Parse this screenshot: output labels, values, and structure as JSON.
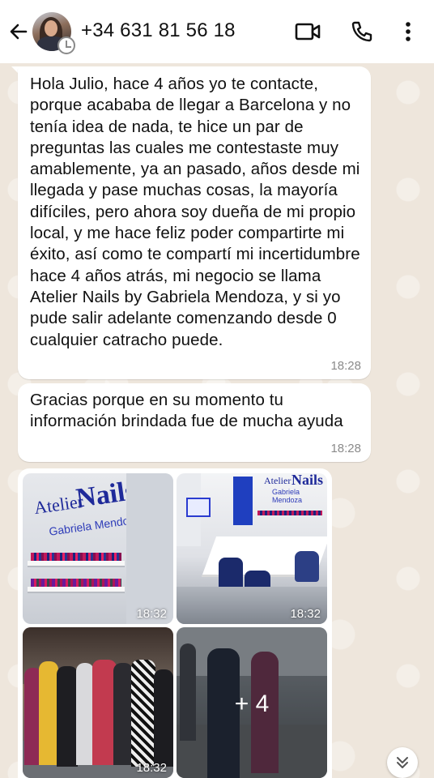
{
  "header": {
    "contact_name": "+34 631 81 56 18",
    "icons": [
      "back-arrow-icon",
      "avatar",
      "video-call-icon",
      "phone-icon",
      "more-vertical-icon"
    ]
  },
  "messages": [
    {
      "text": "Hola Julio, hace 4 años yo te contacte, porque acababa de llegar a Barcelona y no tenía idea de nada, te hice un par de preguntas las cuales me contestaste muy amablemente, ya an pasado, años desde mi llegada y pase muchas cosas, la mayoría difíciles, pero ahora soy dueña de mi propio local, y me hace feliz poder compartirte mi éxito, así como te compartí mi incertidumbre hace 4 años atrás, mi negocio se llama Atelier Nails by Gabriela Mendoza, y si yo pude salir adelante comenzando desde 0 cualquier catracho puede.",
      "time": "18:28"
    },
    {
      "text": "Gracias porque en su momento tu información brindada fue de mucha ayuda",
      "time": "18:28"
    }
  ],
  "album": {
    "photos": [
      {
        "time": "18:32",
        "logo_line1": "Atelier",
        "logo_line2": "Nails",
        "logo_line3": "Gabriela Mendoza"
      },
      {
        "time": "18:32",
        "logo_line1": "Atelier",
        "logo_line2": "Nails",
        "logo_line3": "Gabriela Mendoza"
      },
      {
        "time": "18:32"
      },
      {
        "more_label": "+ 4"
      }
    ]
  },
  "colors": {
    "header_bg": "#ffffff",
    "chat_bg": "#eee6dc",
    "bubble_bg": "#ffffff",
    "timestamp": "#8a8a8a",
    "brand_blue": "#1f2a9a"
  }
}
